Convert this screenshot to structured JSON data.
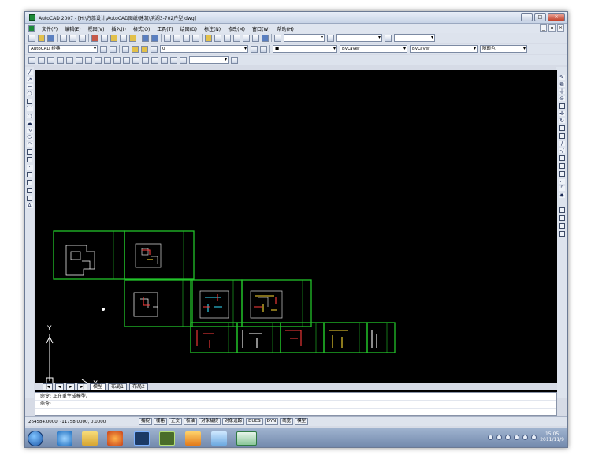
{
  "window": {
    "title": "AutoCAD 2007 - [H:\\方蕊设计\\AutoCAD图纸\\建筑\\滨湖3-702户型.dwg]",
    "buttons": [
      "–",
      "□",
      "×"
    ]
  },
  "menu": [
    "文件(F)",
    "编辑(E)",
    "视图(V)",
    "插入(I)",
    "格式(O)",
    "工具(T)",
    "绘图(D)",
    "标注(N)",
    "修改(M)",
    "窗口(W)",
    "帮助(H)"
  ],
  "toolbar2": {
    "workspace": "AutoCAD 经典",
    "layer": "0",
    "linetype": "ByLayer",
    "lineweight": "ByLayer",
    "plotstyle": "随颜色"
  },
  "tabs": [
    "模型",
    "布局1",
    "布局2"
  ],
  "command": {
    "line1": "命令:  正在重生成模型。",
    "line2": "命令:"
  },
  "status": {
    "coords": "264584.0000, -11758.0000, 0.0000",
    "toggles": [
      "捕捉",
      "栅格",
      "正交",
      "极轴",
      "对象捕捉",
      "对象追踪",
      "DUCS",
      "DYN",
      "线宽",
      "模型"
    ]
  },
  "taskbar": {
    "time": "15:05",
    "date": "2011/11/9"
  },
  "icons": {
    "start": "windows-start-icon",
    "ie": "internet-explorer-icon",
    "explorer": "folder-icon",
    "firefox": "firefox-icon",
    "photoshop": "photoshop-icon",
    "dreamweaver": "dreamweaver-icon",
    "autocad": "autocad-icon"
  },
  "colors": {
    "canvas_bg": "#000000",
    "sheet_border": "#22c32a",
    "taskbar": "#7d93b6"
  }
}
